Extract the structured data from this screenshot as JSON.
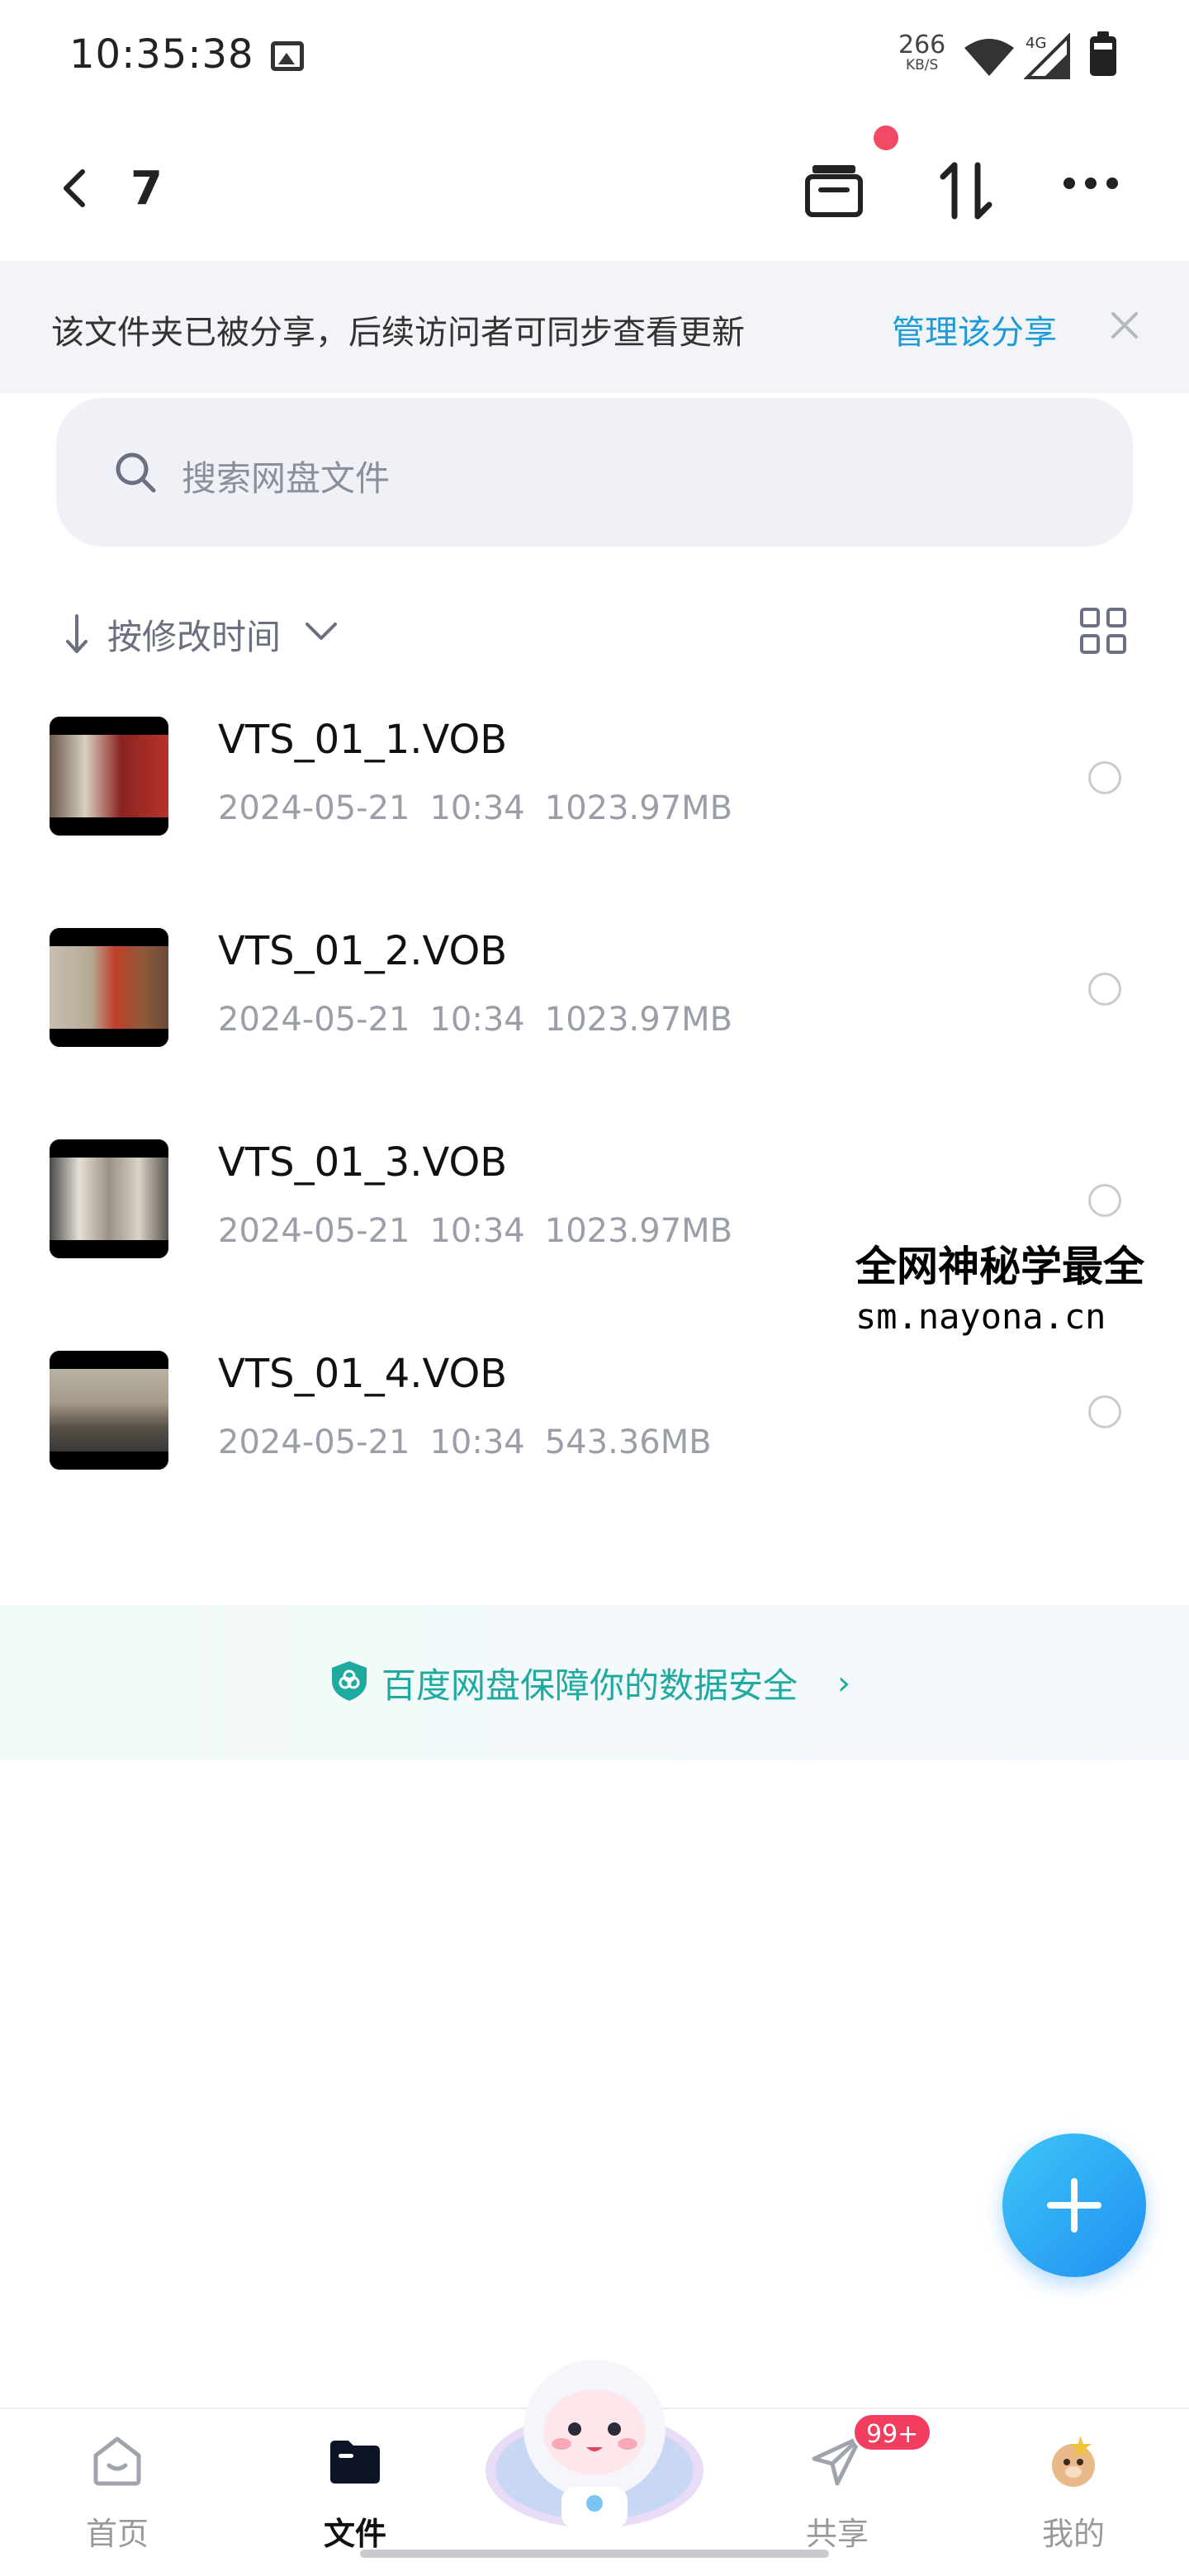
{
  "status_bar": {
    "time": "10:35:38",
    "net_speed": "266",
    "net_speed_unit": "KB/S",
    "network_type": "4G",
    "icons": [
      "image-icon",
      "wifi-icon",
      "signal-icon",
      "battery-icon"
    ]
  },
  "header": {
    "title": "7",
    "icons": [
      "back-icon",
      "transfer-box-icon",
      "sort-arrows-icon",
      "more-icon"
    ]
  },
  "share_banner": {
    "text": "该文件夹已被分享，后续访问者可同步查看更新",
    "link": "管理该分享"
  },
  "search": {
    "placeholder": "搜索网盘文件"
  },
  "sort": {
    "label": "按修改时间"
  },
  "files": [
    {
      "name": "VTS_01_1.VOB",
      "date": "2024-05-21",
      "time": "10:34",
      "size": "1023.97MB"
    },
    {
      "name": "VTS_01_2.VOB",
      "date": "2024-05-21",
      "time": "10:34",
      "size": "1023.97MB"
    },
    {
      "name": "VTS_01_3.VOB",
      "date": "2024-05-21",
      "time": "10:34",
      "size": "1023.97MB"
    },
    {
      "name": "VTS_01_4.VOB",
      "date": "2024-05-21",
      "time": "10:34",
      "size": "543.36MB"
    }
  ],
  "watermark": {
    "line1": "全网神秘学最全",
    "line2": "sm.nayona.cn"
  },
  "safety_banner": {
    "text": "百度网盘保障你的数据安全",
    "chevron": "›"
  },
  "bottom_nav": {
    "items": [
      {
        "label": "首页",
        "icon": "home-icon"
      },
      {
        "label": "文件",
        "icon": "folder-icon"
      },
      {
        "label": "共享",
        "icon": "paper-plane-icon"
      },
      {
        "label": "我的",
        "icon": "avatar-icon"
      }
    ],
    "share_badge": "99+"
  },
  "colors": {
    "accent": "#1d9bd8",
    "badge": "#f23d5e",
    "safety": "#1faaa0"
  }
}
